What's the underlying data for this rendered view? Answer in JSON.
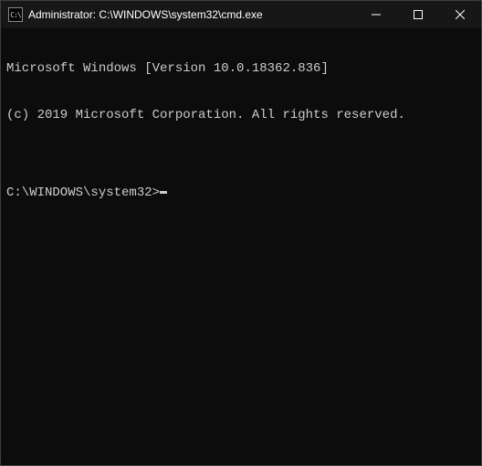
{
  "titlebar": {
    "icon_label": "C:\\",
    "title": "Administrator: C:\\WINDOWS\\system32\\cmd.exe"
  },
  "terminal": {
    "line1": "Microsoft Windows [Version 10.0.18362.836]",
    "line2": "(c) 2019 Microsoft Corporation. All rights reserved.",
    "blank": "",
    "prompt": "C:\\WINDOWS\\system32>"
  }
}
